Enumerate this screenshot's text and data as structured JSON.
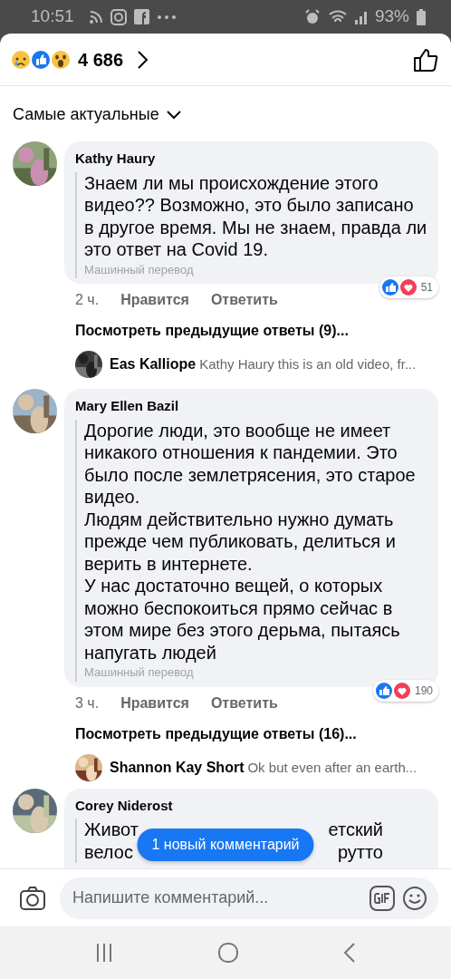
{
  "status_bar": {
    "time": "10:51",
    "battery": "93%"
  },
  "header": {
    "reaction_count": "4 686"
  },
  "sort": {
    "label": "Самые актуальные"
  },
  "comments": [
    {
      "author": "Kathy Haury",
      "paragraphs": [
        "Знаем ли мы происхождение этого видео?? Возможно, это было записано в другое время. Мы не знаем, правда ли это ответ на Covid 19."
      ],
      "translation": "Машинный перевод",
      "time": "2 ч.",
      "like": "Нравится",
      "reply": "Ответить",
      "reaction_count": "51",
      "view_replies": "Посмотреть предыдущие ответы (9)...",
      "latest_reply": {
        "author": "Eas Kalliope",
        "text": "Kathy Haury this is an old video, fr..."
      }
    },
    {
      "author": "Mary Ellen Bazil",
      "paragraphs": [
        "Дорогие люди, это вообще не имеет никакого отношения к пандемии. Это было после землетрясения, это старое видео.",
        "Людям действительно нужно думать прежде чем публиковать, делиться и верить в интернете.",
        "У нас достаточно вещей, о которых можно беспокоиться прямо сейчас в этом мире без этого дерьма, пытаясь напугать людей"
      ],
      "translation": "Машинный перевод",
      "time": "3 ч.",
      "like": "Нравится",
      "reply": "Ответить",
      "reaction_count": "190",
      "view_replies": "Посмотреть предыдущие ответы (16)...",
      "latest_reply": {
        "author": "Shannon Kay Short",
        "text": "Ok but even after an earth..."
      }
    }
  ],
  "partial_comment": {
    "author": "Corey Niderost",
    "lines": [
      {
        "left": "Живот",
        "right": "етский"
      },
      {
        "left": "велос",
        "right": "рутто"
      }
    ]
  },
  "toast": "1 новый комментарий",
  "composer": {
    "placeholder": "Напишите комментарий..."
  }
}
